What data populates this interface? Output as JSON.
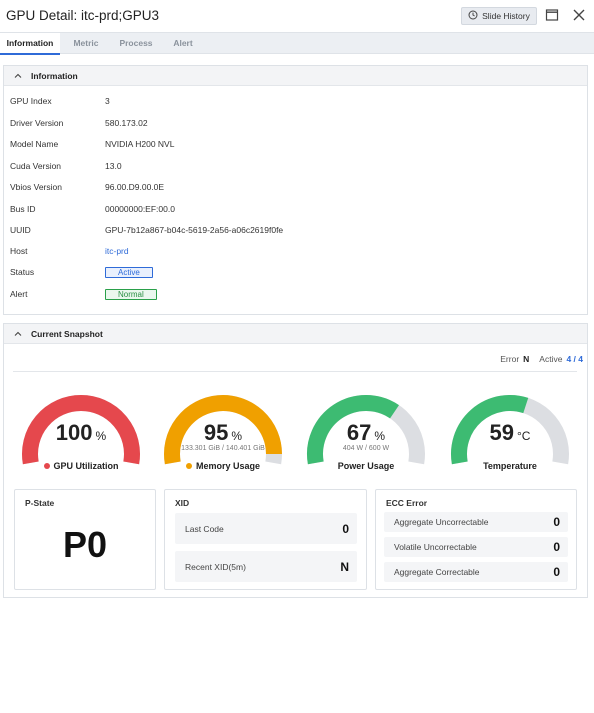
{
  "window": {
    "title": "GPU Detail: itc-prd;GPU3",
    "history_button": "Slide History"
  },
  "tabs": [
    {
      "label": "Information",
      "active": true
    },
    {
      "label": "Metric"
    },
    {
      "label": "Process"
    },
    {
      "label": "Alert"
    }
  ],
  "information": {
    "header": "Information",
    "rows": [
      {
        "label": "GPU Index",
        "value": "3"
      },
      {
        "label": "Driver Version",
        "value": "580.173.02"
      },
      {
        "label": "Model Name",
        "value": "NVIDIA H200 NVL"
      },
      {
        "label": "Cuda Version",
        "value": "13.0"
      },
      {
        "label": "Vbios Version",
        "value": "96.00.D9.00.0E"
      },
      {
        "label": "Bus ID",
        "value": "00000000:EF:00.0"
      },
      {
        "label": "UUID",
        "value": "GPU-7b12a867-b04c-5619-2a56-a06c2619f0fe"
      },
      {
        "label": "Host",
        "value": "itc-prd"
      },
      {
        "label": "Status",
        "value": "Active"
      },
      {
        "label": "Alert",
        "value": "Normal"
      }
    ]
  },
  "snapshot": {
    "header": "Current Snapshot",
    "error_label": "Error",
    "error_value": "N",
    "active_label": "Active",
    "active_value": "4 / 4",
    "gauges": [
      {
        "value": "100",
        "unit": "%",
        "fraction": 1.0,
        "color": "#e5484d",
        "sub": "",
        "label": "GPU Utilization",
        "dot": true
      },
      {
        "value": "95",
        "unit": "%",
        "fraction": 0.95,
        "color": "#f0a000",
        "sub": "133.301 GiB / 140.401 GiB",
        "label": "Memory Usage",
        "dot": true
      },
      {
        "value": "67",
        "unit": "%",
        "fraction": 0.67,
        "color": "#3dbb72",
        "sub": "404 W / 600 W",
        "label": "Power Usage",
        "dot": false
      },
      {
        "value": "59",
        "unit": "°C",
        "fraction": 0.59,
        "color": "#3dbb72",
        "sub": "",
        "label": "Temperature",
        "dot": false
      }
    ],
    "track_color": "#dcdee2",
    "pstate": {
      "title": "P-State",
      "value": "P0"
    },
    "xid": {
      "title": "XID",
      "items": [
        {
          "label": "Last Code",
          "value": "0"
        },
        {
          "label": "Recent XID(5m)",
          "value": "N"
        }
      ]
    },
    "ecc": {
      "title": "ECC Error",
      "items": [
        {
          "label": "Aggregate Uncorrectable",
          "value": "0"
        },
        {
          "label": "Volatile Uncorrectable",
          "value": "0"
        },
        {
          "label": "Aggregate Correctable",
          "value": "0"
        }
      ]
    }
  }
}
